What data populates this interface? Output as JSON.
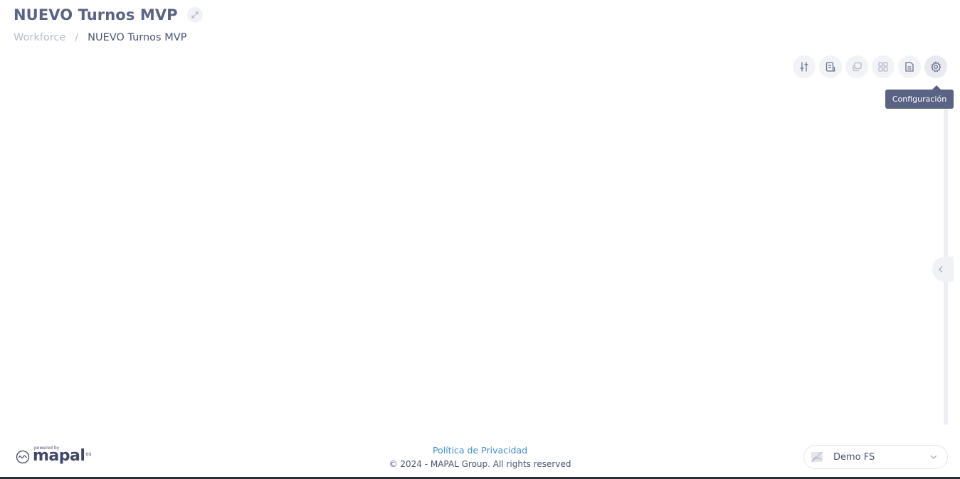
{
  "header": {
    "title": "NUEVO Turnos MVP",
    "breadcrumb": {
      "root": "Workforce",
      "separator": "/",
      "current": "NUEVO Turnos MVP"
    }
  },
  "toolbar": {
    "buttons": [
      {
        "icon": "sliders-icon"
      },
      {
        "icon": "report-icon"
      },
      {
        "icon": "copy-icon"
      },
      {
        "icon": "grid-icon"
      },
      {
        "icon": "document-icon"
      },
      {
        "icon": "gear-icon"
      }
    ],
    "tooltip": "Configuración"
  },
  "footer": {
    "powered_by": "powered by",
    "logo_word": "mapal",
    "logo_suffix": "os",
    "privacy_link": "Política de Privacidad",
    "copyright": "© 2024 - MAPAL Group. All rights reserved"
  },
  "org_selector": {
    "selected": "Demo FS"
  },
  "colors": {
    "title": "#5a6384",
    "link": "#3d8fd0",
    "tooltip_bg": "#5a6384"
  }
}
